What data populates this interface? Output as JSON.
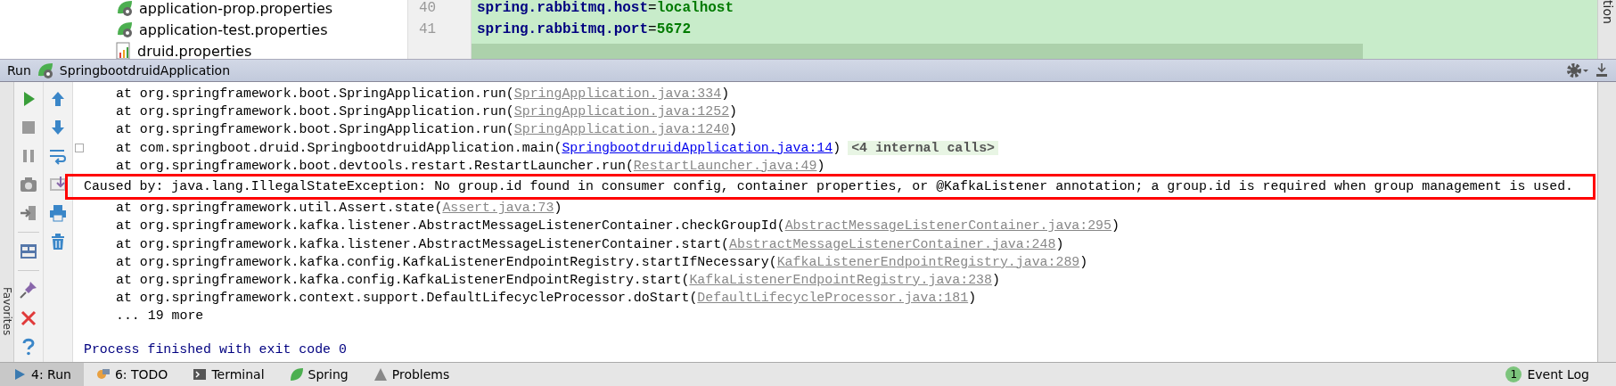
{
  "project_tree": {
    "items": [
      {
        "label": "application-prop.properties",
        "kind": "spring"
      },
      {
        "label": "application-test.properties",
        "kind": "spring"
      },
      {
        "label": "druid.properties",
        "kind": "chart"
      }
    ]
  },
  "editor": {
    "lines": [
      {
        "number": "40",
        "key": "spring.rabbitmq.host",
        "separator": "=",
        "value": "localhost"
      },
      {
        "number": "41",
        "key": "spring.rabbitmq.port",
        "separator": "=",
        "value": "5672"
      }
    ]
  },
  "right_strip_label": "tion",
  "left_strip_label": "Favorites",
  "run_panel": {
    "title": "Run",
    "config": "SpringbootdruidApplication",
    "console": {
      "lines": [
        {
          "kind": "frame",
          "segments": [
            {
              "kind": "plain",
              "text": "at org.springframework.boot.SpringApplication.run("
            },
            {
              "kind": "link",
              "text": "SpringApplication.java:334"
            },
            {
              "kind": "plain",
              "text": ")"
            }
          ]
        },
        {
          "kind": "frame",
          "segments": [
            {
              "kind": "plain",
              "text": "at org.springframework.boot.SpringApplication.run("
            },
            {
              "kind": "link",
              "text": "SpringApplication.java:1252"
            },
            {
              "kind": "plain",
              "text": ")"
            }
          ]
        },
        {
          "kind": "frame",
          "segments": [
            {
              "kind": "plain",
              "text": "at org.springframework.boot.SpringApplication.run("
            },
            {
              "kind": "link",
              "text": "SpringApplication.java:1240"
            },
            {
              "kind": "plain",
              "text": ")"
            }
          ]
        },
        {
          "kind": "foldable_frame",
          "segments": [
            {
              "kind": "plain",
              "text": "at com.springboot.druid.SpringbootdruidApplication.main("
            },
            {
              "kind": "user_link",
              "text": "SpringbootdruidApplication.java:14"
            },
            {
              "kind": "plain",
              "text": ")"
            },
            {
              "kind": "folded",
              "text": "<4 internal calls>"
            }
          ]
        },
        {
          "kind": "frame",
          "segments": [
            {
              "kind": "plain",
              "text": "at org.springframework.boot.devtools.restart.RestartLauncher.run("
            },
            {
              "kind": "link",
              "text": "RestartLauncher.java:49"
            },
            {
              "kind": "plain",
              "text": ")"
            }
          ]
        },
        {
          "kind": "cause",
          "segments": [
            {
              "kind": "plain",
              "text": "Caused by: java.lang.IllegalStateException: No group.id found in consumer config, container properties, or @KafkaListener annotation; a group.id is required when group management is used."
            }
          ]
        },
        {
          "kind": "frame",
          "segments": [
            {
              "kind": "plain",
              "text": "at org.springframework.util.Assert.state("
            },
            {
              "kind": "link",
              "text": "Assert.java:73"
            },
            {
              "kind": "plain",
              "text": ")"
            }
          ]
        },
        {
          "kind": "frame",
          "segments": [
            {
              "kind": "plain",
              "text": "at org.springframework.kafka.listener.AbstractMessageListenerContainer.checkGroupId("
            },
            {
              "kind": "link",
              "text": "AbstractMessageListenerContainer.java:295"
            },
            {
              "kind": "plain",
              "text": ")"
            }
          ]
        },
        {
          "kind": "frame",
          "segments": [
            {
              "kind": "plain",
              "text": "at org.springframework.kafka.listener.AbstractMessageListenerContainer.start("
            },
            {
              "kind": "link",
              "text": "AbstractMessageListenerContainer.java:248"
            },
            {
              "kind": "plain",
              "text": ")"
            }
          ]
        },
        {
          "kind": "frame",
          "segments": [
            {
              "kind": "plain",
              "text": "at org.springframework.kafka.config.KafkaListenerEndpointRegistry.startIfNecessary("
            },
            {
              "kind": "link",
              "text": "KafkaListenerEndpointRegistry.java:289"
            },
            {
              "kind": "plain",
              "text": ")"
            }
          ]
        },
        {
          "kind": "frame",
          "segments": [
            {
              "kind": "plain",
              "text": "at org.springframework.kafka.config.KafkaListenerEndpointRegistry.start("
            },
            {
              "kind": "link",
              "text": "KafkaListenerEndpointRegistry.java:238"
            },
            {
              "kind": "plain",
              "text": ")"
            }
          ]
        },
        {
          "kind": "frame",
          "segments": [
            {
              "kind": "plain",
              "text": "at org.springframework.context.support.DefaultLifecycleProcessor.doStart("
            },
            {
              "kind": "link",
              "text": "DefaultLifecycleProcessor.java:181"
            },
            {
              "kind": "plain",
              "text": ")"
            }
          ]
        },
        {
          "kind": "more",
          "segments": [
            {
              "kind": "plain",
              "text": "... 19 more"
            }
          ]
        }
      ],
      "exit_message": "Process finished with exit code 0"
    }
  },
  "tool_tabs": [
    {
      "label": "4: Run",
      "kind": "run",
      "selected": true
    },
    {
      "label": "6: TODO",
      "kind": "todo",
      "selected": false
    },
    {
      "label": "Terminal",
      "kind": "terminal",
      "selected": false
    },
    {
      "label": "Spring",
      "kind": "spring",
      "selected": false
    },
    {
      "label": "Problems",
      "kind": "problems",
      "selected": false
    }
  ],
  "event_log": {
    "count": "1",
    "label": "Event Log"
  }
}
